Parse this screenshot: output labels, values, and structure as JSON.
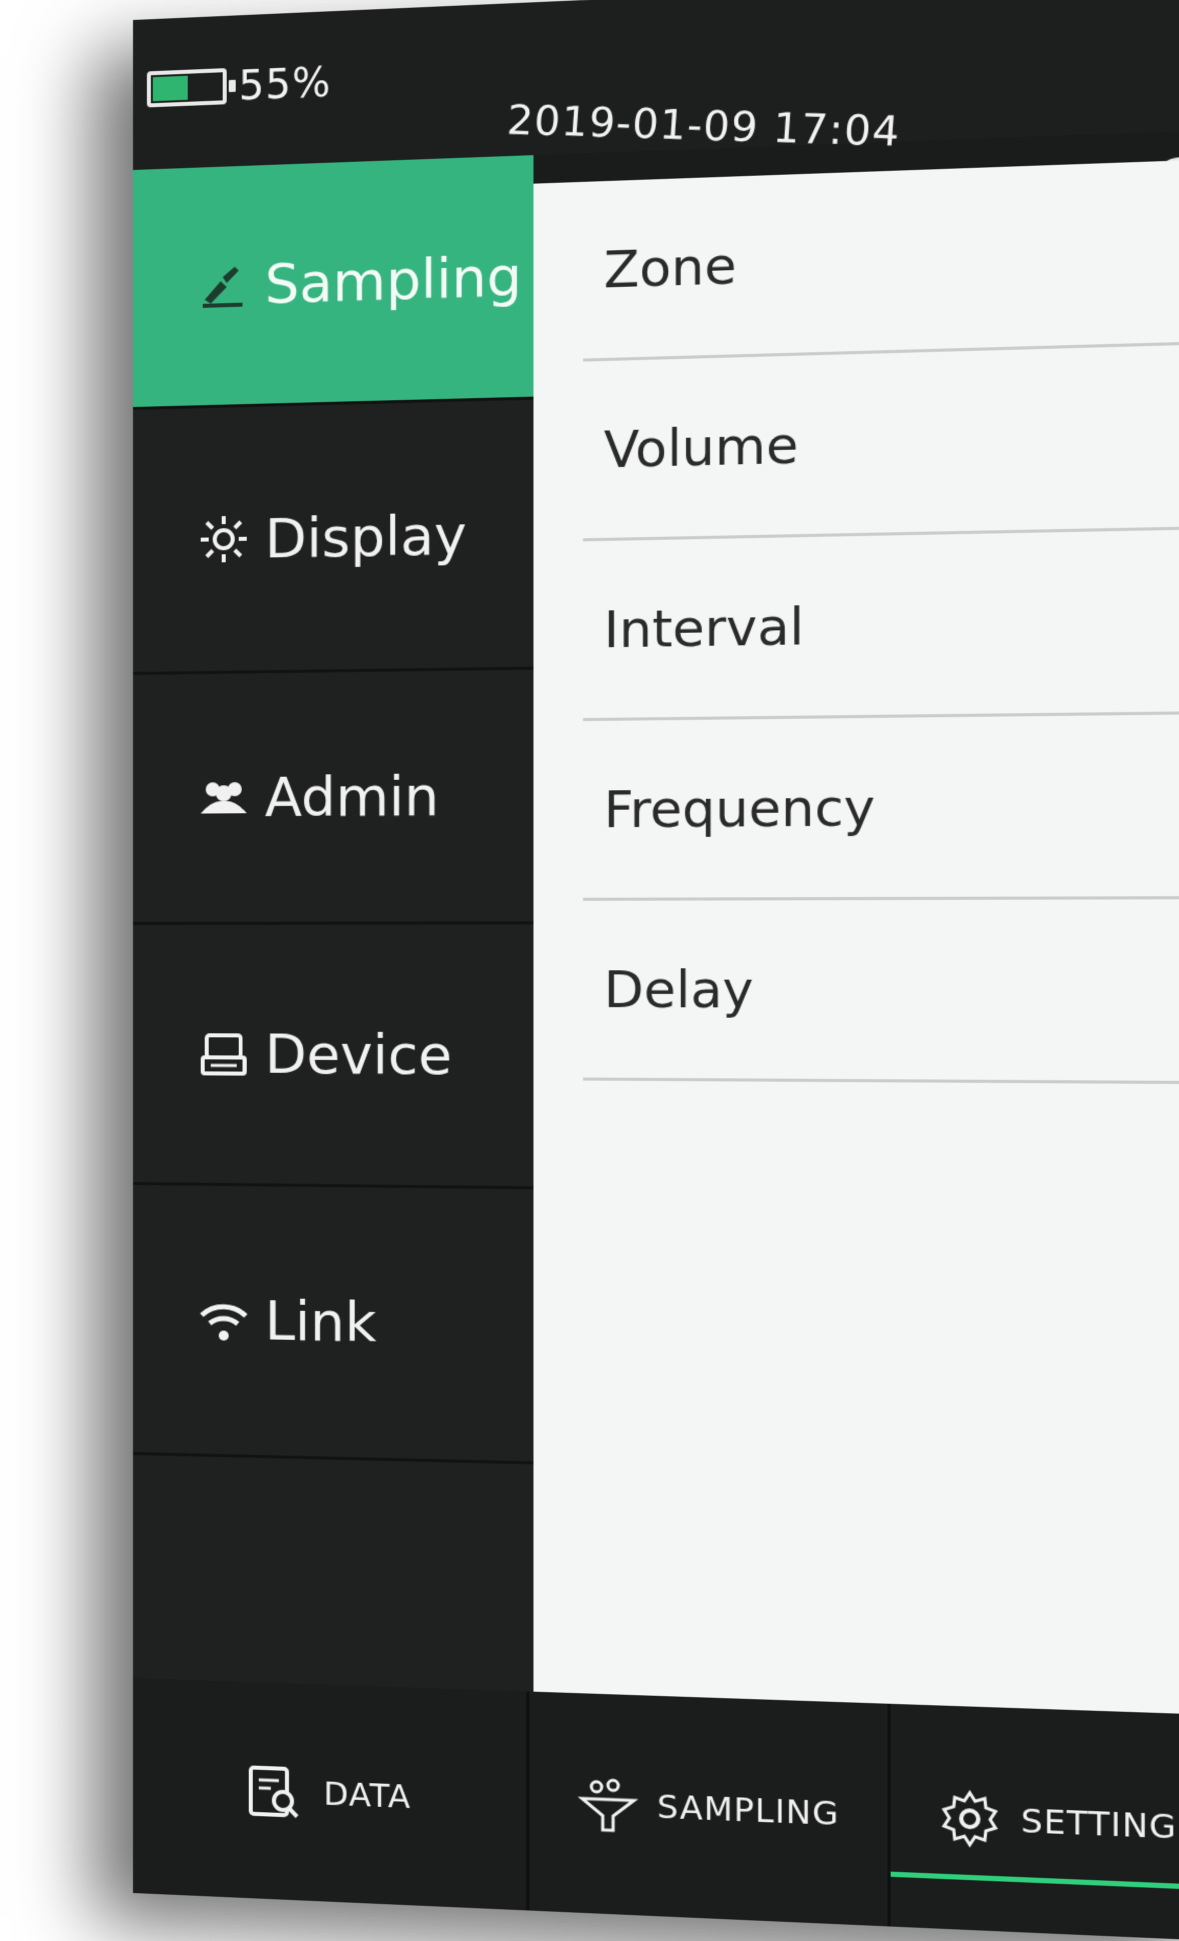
{
  "status": {
    "battery_level": 0.55,
    "battery_text": "55%",
    "datetime": "2019-01-09 17:04",
    "wifi_icon": "wifi-icon"
  },
  "sidebar": {
    "items": [
      {
        "label": "Sampling",
        "icon": "sampling-icon",
        "active": true
      },
      {
        "label": "Display",
        "icon": "brightness-icon",
        "active": false
      },
      {
        "label": "Admin",
        "icon": "users-icon",
        "active": false
      },
      {
        "label": "Device",
        "icon": "device-icon",
        "active": false
      },
      {
        "label": "Link",
        "icon": "wifi-icon",
        "active": false
      }
    ]
  },
  "content": {
    "rows": [
      "Zone",
      "Volume",
      "Interval",
      "Frequency",
      "Delay"
    ]
  },
  "bottom_tabs": [
    {
      "label": "DATA",
      "icon": "data-search-icon"
    },
    {
      "label": "SAMPLING",
      "icon": "sampling-funnel-icon"
    },
    {
      "label": "SETTING",
      "icon": "gear-icon",
      "active": true
    }
  ],
  "colors": {
    "accent": "#36b47f",
    "background_dark": "#1f2120",
    "content_bg": "#f4f6f5",
    "active_tab_line": "#2fcf7c"
  }
}
